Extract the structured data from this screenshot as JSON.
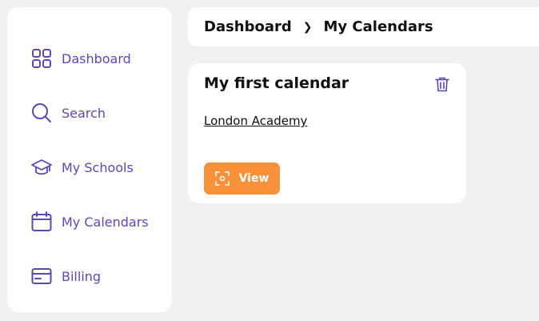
{
  "sidebar": {
    "items": [
      {
        "label": "Dashboard",
        "icon": "dashboard-grid-icon"
      },
      {
        "label": "Search",
        "icon": "search-icon"
      },
      {
        "label": "My Schools",
        "icon": "graduation-cap-icon"
      },
      {
        "label": "My Calendars",
        "icon": "calendar-icon"
      },
      {
        "label": "Billing",
        "icon": "credit-card-icon"
      }
    ]
  },
  "breadcrumb": {
    "items": [
      "Dashboard",
      "My Calendars"
    ]
  },
  "card": {
    "title": "My first calendar",
    "link": "London Academy",
    "view_label": "View"
  },
  "colors": {
    "accent": "#5b47b8",
    "button": "#f7923a",
    "background": "#f1f1f1"
  }
}
